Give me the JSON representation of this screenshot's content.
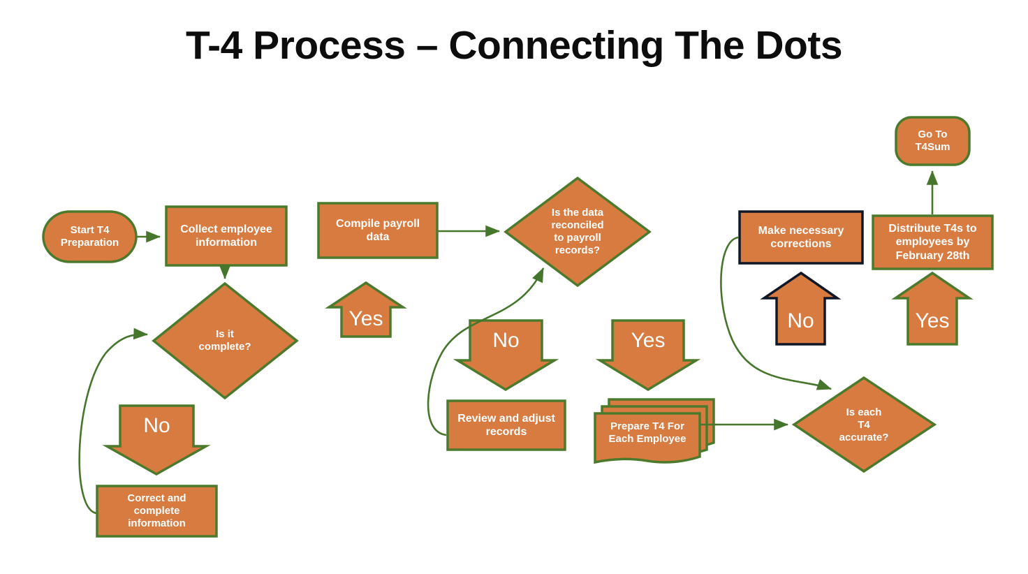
{
  "slide": {
    "title": "T-4 Process – Connecting The Dots",
    "background": "#ffffff",
    "title_color": "#0d0d0d"
  },
  "theme": {
    "fill": "#D77B40",
    "stroke_green": "#4C7A2C",
    "stroke_navy": "#101828",
    "text": "#ffffff",
    "connector": "#46762C"
  },
  "nodes": {
    "start": {
      "label": "Start T4\nPreparation",
      "shape": "rounded-terminator",
      "border": "#4C7A2C"
    },
    "collect": {
      "label": "Collect employee\ninformation",
      "shape": "rectangle",
      "border": "#4C7A2C"
    },
    "is_complete": {
      "label": "Is it\ncomplete?",
      "shape": "diamond",
      "border": "#4C7A2C"
    },
    "no_complete": {
      "label": "No",
      "shape": "down-arrow",
      "border": "#4C7A2C"
    },
    "correct": {
      "label": "Correct and\ncomplete\ninformation",
      "shape": "rectangle",
      "border": "#4C7A2C"
    },
    "yes_complete": {
      "label": "Yes",
      "shape": "up-arrow",
      "border": "#4C7A2C"
    },
    "compile": {
      "label": "Compile payroll\ndata",
      "shape": "rectangle",
      "border": "#4C7A2C"
    },
    "is_reconciled": {
      "label": "Is the data\nreconciled\nto payroll\nrecords?",
      "shape": "diamond",
      "border": "#4C7A2C"
    },
    "no_reconciled": {
      "label": "No",
      "shape": "down-arrow",
      "border": "#4C7A2C"
    },
    "review": {
      "label": "Review and adjust\nrecords",
      "shape": "rectangle",
      "border": "#4C7A2C"
    },
    "yes_reconciled": {
      "label": "Yes",
      "shape": "down-arrow",
      "border": "#4C7A2C"
    },
    "prepare_t4": {
      "label": "Prepare T4 For\nEach Employee",
      "shape": "multi-document",
      "border": "#4C7A2C"
    },
    "is_accurate": {
      "label": "Is each\nT4\naccurate?",
      "shape": "diamond",
      "border": "#4C7A2C"
    },
    "no_accurate": {
      "label": "No",
      "shape": "up-arrow",
      "border": "#101828"
    },
    "corrections": {
      "label": "Make necessary\ncorrections",
      "shape": "rectangle",
      "border": "#101828"
    },
    "yes_accurate": {
      "label": "Yes",
      "shape": "up-arrow",
      "border": "#4C7A2C"
    },
    "distribute": {
      "label": "Distribute T4s to\nemployees by\nFebruary 28th",
      "shape": "rectangle",
      "border": "#4C7A2C"
    },
    "go_to_t4sum": {
      "label": "Go To\nT4Sum",
      "shape": "rounded-terminator",
      "border": "#4C7A2C"
    }
  },
  "connectors": [
    {
      "name": "start-to-collect",
      "from": "start",
      "to": "collect",
      "style": "straight-arrow"
    },
    {
      "name": "collect-to-is-complete",
      "from": "collect",
      "to": "is_complete",
      "style": "straight-arrow"
    },
    {
      "name": "correct-to-is-complete",
      "from": "correct",
      "to": "is_complete",
      "style": "curved-arrow"
    },
    {
      "name": "compile-to-is-reconciled",
      "from": "compile",
      "to": "is_reconciled",
      "style": "straight-arrow"
    },
    {
      "name": "review-to-is-reconciled",
      "from": "review",
      "to": "is_reconciled",
      "style": "curved-arrow"
    },
    {
      "name": "prepare-to-is-accurate",
      "from": "prepare_t4",
      "to": "is_accurate",
      "style": "straight-arrow"
    },
    {
      "name": "corrections-to-is-accurate",
      "from": "corrections",
      "to": "is_accurate",
      "style": "curved-arrow"
    },
    {
      "name": "distribute-to-go-to-t4sum",
      "from": "distribute",
      "to": "go_to_t4sum",
      "style": "straight-arrow"
    }
  ]
}
